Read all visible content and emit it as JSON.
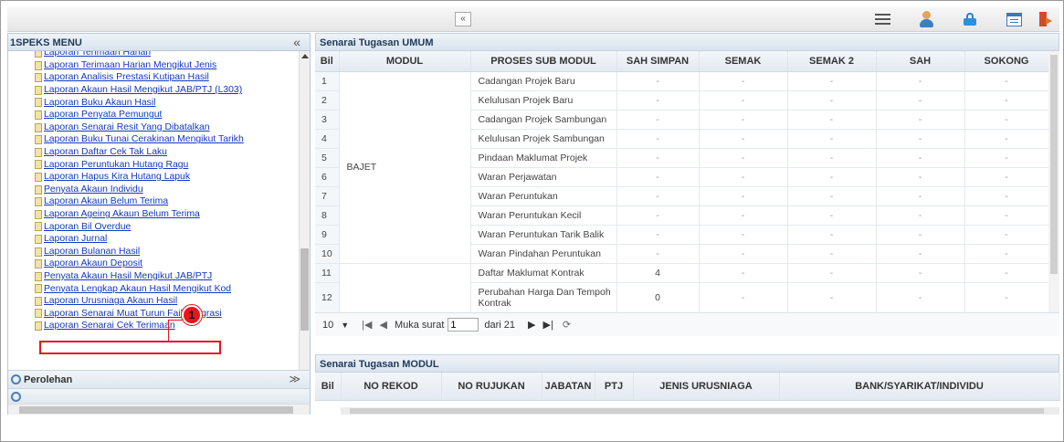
{
  "topbar": {
    "collapse_glyph": "«"
  },
  "left": {
    "title": "1SPEKS MENU",
    "collapse_glyph": "«",
    "items": [
      "Laporan Terimaan Harian",
      "Laporan Terimaan Harian Mengikut Jenis",
      "Laporan Analisis Prestasi Kutipan Hasil",
      "Laporan Akaun Hasil Mengikut JAB/PTJ (L303)",
      "Laporan Buku Akaun Hasil",
      "Laporan Penyata Pemungut",
      "Laporan Senarai Resit Yang Dibatalkan",
      "Laporan Buku Tunai Cerakinan Mengikut Tarikh",
      "Laporan Daftar Cek Tak Laku",
      "Laporan Peruntukan Hutang Ragu",
      "Laporan Hapus Kira Hutang Lapuk",
      "Penyata Akaun Individu",
      "Laporan Akaun Belum Terima",
      "Laporan Ageing Akaun Belum Terima",
      "Laporan Bil Overdue",
      "Laporan Jurnal",
      "Laporan Bulanan Hasil",
      "Laporan Akaun Deposit",
      "Penyata Akaun Hasil Mengikut JAB/PTJ",
      "Penyata Lengkap Akaun Hasil Mengikut Kod",
      "Laporan Urusniaga Akaun Hasil",
      "Laporan Senarai Muat Turun Fail Integrasi",
      "Laporan Senarai Cek Terimaan"
    ],
    "section_label": "Perolehan",
    "section_chevron": "≫",
    "callout_number": "1"
  },
  "umum": {
    "title": "Senarai Tugasan UMUM",
    "columns": [
      "Bil",
      "MODUL",
      "PROSES SUB MODUL",
      "SAH SIMPAN",
      "SEMAK",
      "SEMAK 2",
      "SAH",
      "SOKONG"
    ],
    "modul_label": "BAJET",
    "rows": [
      {
        "bil": "1",
        "proses": "Cadangan Projek Baru",
        "sah_simpan": "-",
        "semak": "-",
        "semak2": "-",
        "sah": "-",
        "sokong": "-"
      },
      {
        "bil": "2",
        "proses": "Kelulusan Projek Baru",
        "sah_simpan": "-",
        "semak": "-",
        "semak2": "-",
        "sah": "-",
        "sokong": "-"
      },
      {
        "bil": "3",
        "proses": "Cadangan Projek Sambungan",
        "sah_simpan": "-",
        "semak": "-",
        "semak2": "-",
        "sah": "-",
        "sokong": "-"
      },
      {
        "bil": "4",
        "proses": "Kelulusan Projek Sambungan",
        "sah_simpan": "-",
        "semak": "-",
        "semak2": "-",
        "sah": "-",
        "sokong": "-"
      },
      {
        "bil": "5",
        "proses": "Pindaan Maklumat Projek",
        "sah_simpan": "-",
        "semak": "-",
        "semak2": "-",
        "sah": "-",
        "sokong": "-"
      },
      {
        "bil": "6",
        "proses": "Waran Perjawatan",
        "sah_simpan": "-",
        "semak": "-",
        "semak2": "-",
        "sah": "-",
        "sokong": "-"
      },
      {
        "bil": "7",
        "proses": "Waran Peruntukan",
        "sah_simpan": "-",
        "semak": "-",
        "semak2": "-",
        "sah": "-",
        "sokong": "-"
      },
      {
        "bil": "8",
        "proses": "Waran Peruntukan Kecil",
        "sah_simpan": "-",
        "semak": "-",
        "semak2": "-",
        "sah": "-",
        "sokong": "-"
      },
      {
        "bil": "9",
        "proses": "Waran Peruntukan Tarik Balik",
        "sah_simpan": "-",
        "semak": "-",
        "semak2": "-",
        "sah": "-",
        "sokong": "-"
      },
      {
        "bil": "10",
        "proses": "Waran Pindahan Peruntukan",
        "sah_simpan": "-",
        "semak": "-",
        "semak2": "-",
        "sah": "-",
        "sokong": "-"
      },
      {
        "bil": "11",
        "proses": "Daftar Maklumat Kontrak",
        "sah_simpan": "4",
        "semak": "-",
        "semak2": "-",
        "sah": "-",
        "sokong": "-"
      },
      {
        "bil": "12",
        "proses": "Perubahan Harga Dan Tempoh Kontrak",
        "sah_simpan": "0",
        "semak": "-",
        "semak2": "-",
        "sah": "-",
        "sokong": "-"
      }
    ],
    "pager": {
      "page_size": "10",
      "page_label": "Muka surat",
      "current_page": "1",
      "total_label": "dari 21"
    }
  },
  "modul": {
    "title": "Senarai Tugasan MODUL",
    "columns": [
      "Bil",
      "NO REKOD",
      "NO RUJUKAN",
      "JABATAN",
      "PTJ",
      "JENIS URUSNIAGA",
      "BANK/SYARIKAT/INDIVIDU"
    ]
  },
  "colors": {
    "link": "#1238c2",
    "highlight": "#e5161d",
    "header_bg": "#dae4ee"
  }
}
